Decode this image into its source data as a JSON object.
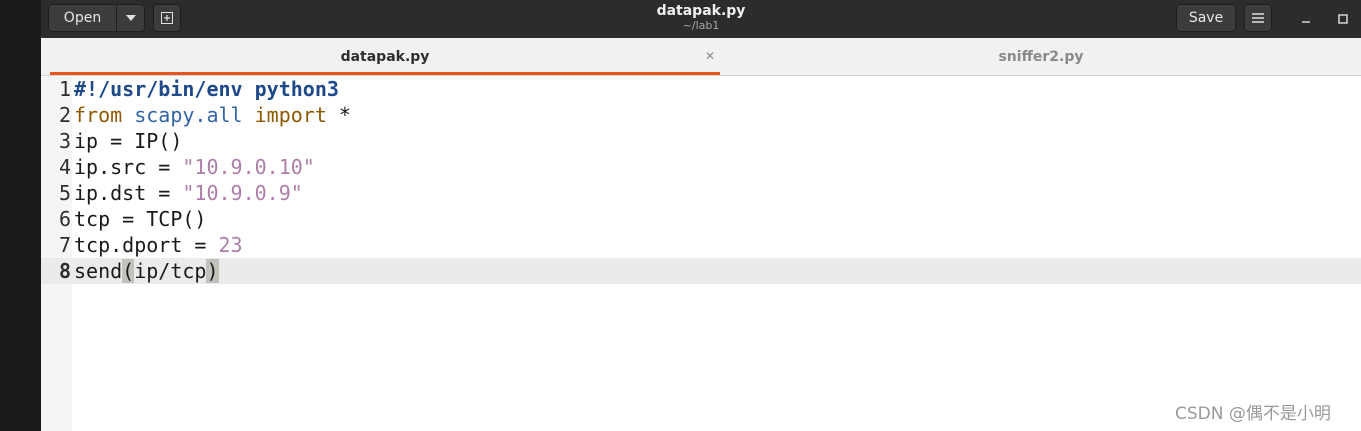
{
  "header": {
    "open_label": "Open",
    "save_label": "Save",
    "title": "datapak.py",
    "subtitle": "~/lab1"
  },
  "tabs": [
    {
      "label": "datapak.py",
      "active": true
    },
    {
      "label": "sniffer2.py",
      "active": false
    }
  ],
  "editor": {
    "current_line": 8,
    "lines": [
      {
        "num": "1",
        "tokens": [
          {
            "t": "#!/usr/bin/env python3",
            "c": "shebang"
          }
        ]
      },
      {
        "num": "2",
        "tokens": [
          {
            "t": "from",
            "c": "kw"
          },
          {
            "t": " ",
            "c": ""
          },
          {
            "t": "scapy.all",
            "c": "mod"
          },
          {
            "t": " ",
            "c": ""
          },
          {
            "t": "import",
            "c": "kw"
          },
          {
            "t": " *",
            "c": ""
          }
        ]
      },
      {
        "num": "3",
        "tokens": [
          {
            "t": "ip = IP()",
            "c": ""
          }
        ]
      },
      {
        "num": "4",
        "tokens": [
          {
            "t": "ip.src = ",
            "c": ""
          },
          {
            "t": "\"10.9.0.10\"",
            "c": "str"
          }
        ]
      },
      {
        "num": "5",
        "tokens": [
          {
            "t": "ip.dst = ",
            "c": ""
          },
          {
            "t": "\"10.9.0.9\"",
            "c": "str"
          }
        ]
      },
      {
        "num": "6",
        "tokens": [
          {
            "t": "tcp = TCP()",
            "c": ""
          }
        ]
      },
      {
        "num": "7",
        "tokens": [
          {
            "t": "tcp.dport = ",
            "c": ""
          },
          {
            "t": "23",
            "c": "num"
          }
        ]
      },
      {
        "num": "8",
        "tokens": [
          {
            "t": "send",
            "c": ""
          },
          {
            "t": "(",
            "c": "paren-hl"
          },
          {
            "t": "ip/tcp",
            "c": ""
          },
          {
            "t": ")",
            "c": "paren-hl"
          }
        ]
      }
    ]
  },
  "watermark": "CSDN @偶不是小明",
  "colors": {
    "accent": "#e95420",
    "headerbar": "#2c2c2c",
    "current_line": "#ebebeb"
  }
}
